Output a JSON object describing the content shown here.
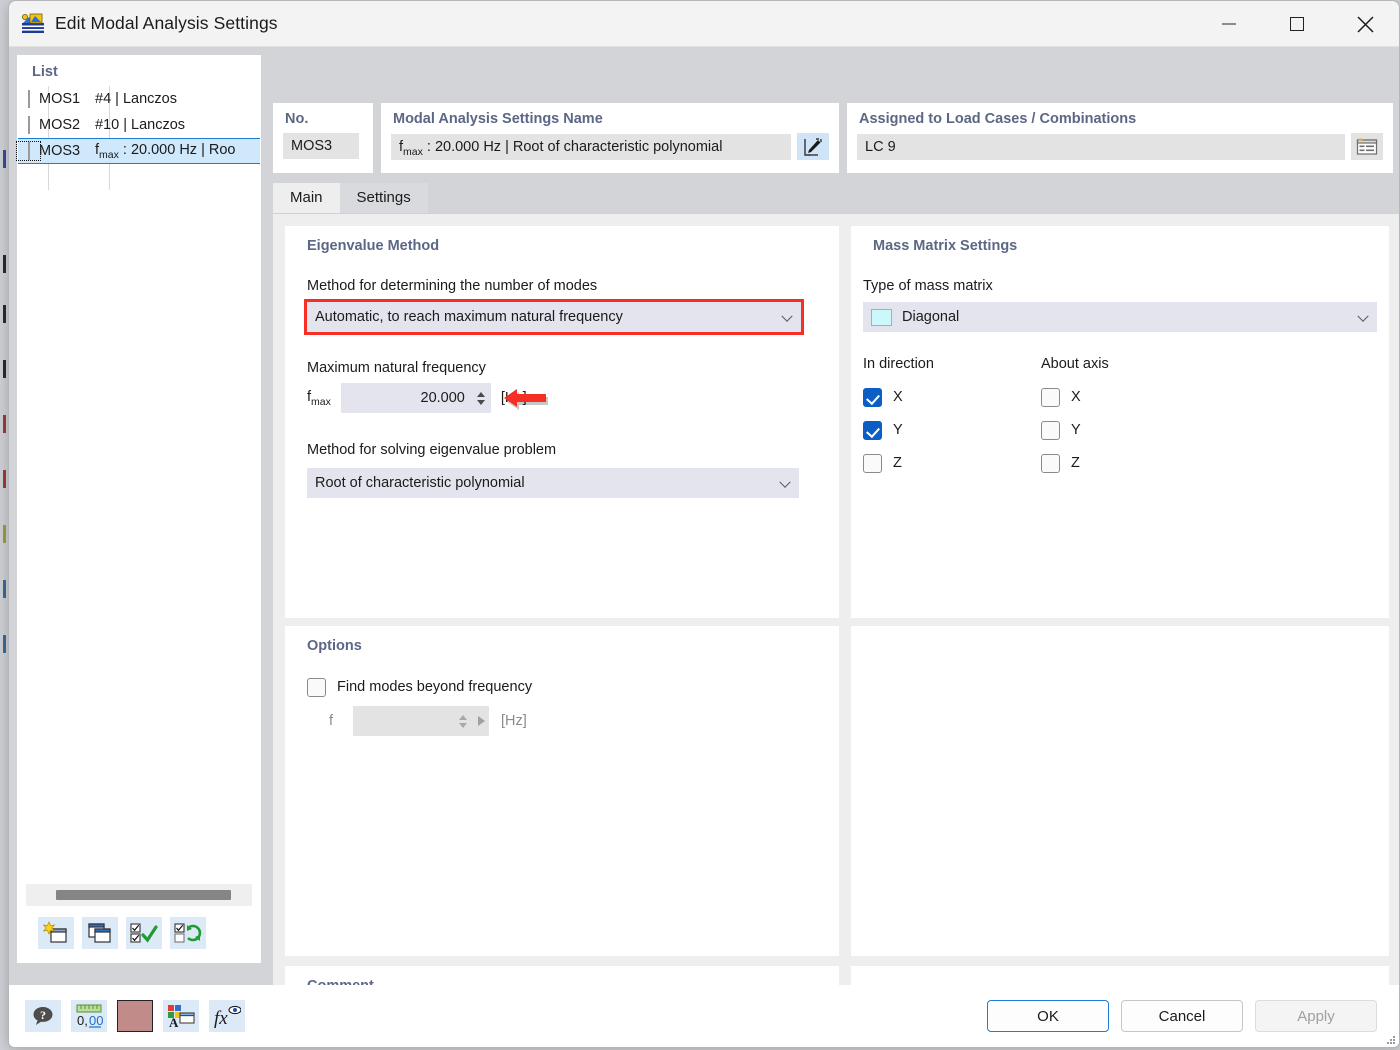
{
  "window": {
    "title": "Edit Modal Analysis Settings",
    "icon": "modal-analysis-icon",
    "minimize_label": "Minimize",
    "maximize_label": "Maximize",
    "close_label": "Close"
  },
  "list_panel": {
    "title": "List",
    "rows": [
      {
        "code": "MOS1",
        "desc": "#4 | Lanczos",
        "color": "#ccf7fb",
        "selected": false
      },
      {
        "code": "MOS2",
        "desc": "#10 | Lanczos",
        "color": "#f5c400",
        "selected": false
      },
      {
        "code": "MOS3",
        "desc": "fₘₐₓ : 20.000 Hz | Roo",
        "color": "#7d738f",
        "selected": true
      }
    ],
    "toolbar": [
      {
        "name": "new-item-button",
        "icon": "new-window-star-icon"
      },
      {
        "name": "copy-item-button",
        "icon": "copy-window-icon"
      },
      {
        "name": "select-all-button",
        "icon": "checkbox-check-icon"
      },
      {
        "name": "invert-selection-button",
        "icon": "checkbox-refresh-icon"
      }
    ]
  },
  "header": {
    "no_label": "No.",
    "no_value": "MOS3",
    "name_label": "Modal Analysis Settings Name",
    "name_value_prefix": "f",
    "name_value_sub": "max",
    "name_value_rest": " : 20.000 Hz | Root of characteristic polynomial",
    "name_edit_icon": "edit-pencil-icon",
    "lc_label": "Assigned to Load Cases / Combinations",
    "lc_value": "LC 9",
    "lc_icon": "list-table-icon"
  },
  "tabs": [
    {
      "label": "Main",
      "active": true
    },
    {
      "label": "Settings",
      "active": false
    }
  ],
  "eigenvalue": {
    "group_title": "Eigenvalue Method",
    "method_modes_label": "Method for determining the number of modes",
    "method_modes_value": "Automatic, to reach maximum natural frequency",
    "max_freq_label": "Maximum natural frequency",
    "fmax_symbol": "f",
    "fmax_sub": "max",
    "fmax_value": "20.000",
    "fmax_unit": "[Hz]",
    "solve_label": "Method for solving eigenvalue problem",
    "solve_value": "Root of characteristic polynomial",
    "highlight_color": "#f52f24"
  },
  "mass_matrix": {
    "group_title": "Mass Matrix Settings",
    "type_label": "Type of mass matrix",
    "type_value": "Diagonal",
    "type_swatch": "#ccf7fb",
    "in_direction_label": "In direction",
    "about_axis_label": "About axis",
    "in_direction": [
      {
        "label": "X",
        "checked": true
      },
      {
        "label": "Y",
        "checked": true
      },
      {
        "label": "Z",
        "checked": false
      }
    ],
    "about_axis": [
      {
        "label": "X",
        "checked": false
      },
      {
        "label": "Y",
        "checked": false
      },
      {
        "label": "Z",
        "checked": false
      }
    ],
    "checked_color": "#0b5ec4"
  },
  "options": {
    "group_title": "Options",
    "find_modes_label": "Find modes beyond frequency",
    "find_modes_checked": false,
    "f_symbol": "f",
    "f_value": "",
    "f_unit": "[Hz]"
  },
  "comment": {
    "group_title": "Comment",
    "value": "",
    "icon": "copy-pages-icon"
  },
  "footer": {
    "tools": [
      {
        "name": "help-button",
        "icon": "question-balloon-icon"
      },
      {
        "name": "decimal-places-button",
        "icon": "number-format-icon"
      },
      {
        "name": "color-button",
        "icon": "color-swatch-icon",
        "color": "#c08b88"
      },
      {
        "name": "display-properties-button",
        "icon": "text-properties-icon"
      },
      {
        "name": "formula-button",
        "icon": "fx-eye-icon"
      }
    ],
    "ok_label": "OK",
    "cancel_label": "Cancel",
    "apply_label": "Apply",
    "apply_enabled": false
  }
}
